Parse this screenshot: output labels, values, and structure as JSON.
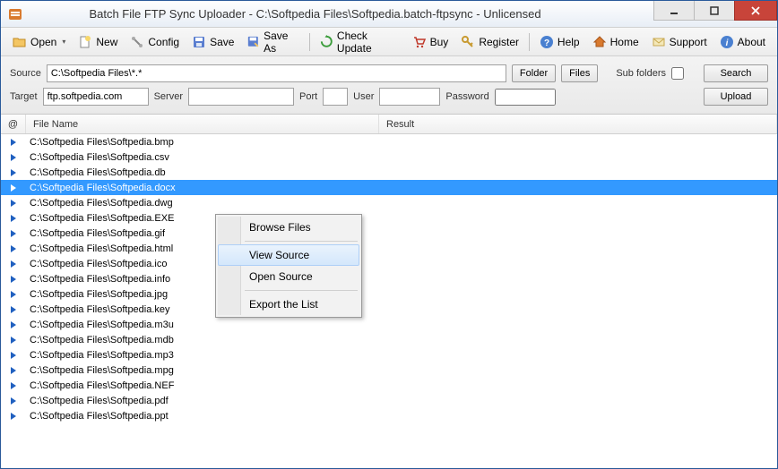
{
  "window": {
    "title": "Batch File FTP Sync Uploader - C:\\Softpedia Files\\Softpedia.batch-ftpsync - Unlicensed"
  },
  "toolbar": {
    "open": "Open",
    "new": "New",
    "config": "Config",
    "save": "Save",
    "saveas": "Save As",
    "checkupdate": "Check Update",
    "buy": "Buy",
    "register": "Register",
    "help": "Help",
    "home": "Home",
    "support": "Support",
    "about": "About"
  },
  "filters": {
    "source_label": "Source",
    "source_value": "C:\\Softpedia Files\\*.*",
    "folder_btn": "Folder",
    "files_btn": "Files",
    "subfolders_label": "Sub folders",
    "search_btn": "Search",
    "target_label": "Target",
    "target_value": "ftp.softpedia.com",
    "server_label": "Server",
    "server_value": "",
    "port_label": "Port",
    "port_value": "",
    "user_label": "User",
    "user_value": "",
    "password_label": "Password",
    "password_value": "",
    "upload_btn": "Upload"
  },
  "columns": {
    "at": "@",
    "filename": "File Name",
    "result": "Result"
  },
  "files": [
    {
      "name": "C:\\Softpedia Files\\Softpedia.bmp",
      "selected": false
    },
    {
      "name": "C:\\Softpedia Files\\Softpedia.csv",
      "selected": false
    },
    {
      "name": "C:\\Softpedia Files\\Softpedia.db",
      "selected": false
    },
    {
      "name": "C:\\Softpedia Files\\Softpedia.docx",
      "selected": true
    },
    {
      "name": "C:\\Softpedia Files\\Softpedia.dwg",
      "selected": false
    },
    {
      "name": "C:\\Softpedia Files\\Softpedia.EXE",
      "selected": false
    },
    {
      "name": "C:\\Softpedia Files\\Softpedia.gif",
      "selected": false
    },
    {
      "name": "C:\\Softpedia Files\\Softpedia.html",
      "selected": false
    },
    {
      "name": "C:\\Softpedia Files\\Softpedia.ico",
      "selected": false
    },
    {
      "name": "C:\\Softpedia Files\\Softpedia.info",
      "selected": false
    },
    {
      "name": "C:\\Softpedia Files\\Softpedia.jpg",
      "selected": false
    },
    {
      "name": "C:\\Softpedia Files\\Softpedia.key",
      "selected": false
    },
    {
      "name": "C:\\Softpedia Files\\Softpedia.m3u",
      "selected": false
    },
    {
      "name": "C:\\Softpedia Files\\Softpedia.mdb",
      "selected": false
    },
    {
      "name": "C:\\Softpedia Files\\Softpedia.mp3",
      "selected": false
    },
    {
      "name": "C:\\Softpedia Files\\Softpedia.mpg",
      "selected": false
    },
    {
      "name": "C:\\Softpedia Files\\Softpedia.NEF",
      "selected": false
    },
    {
      "name": "C:\\Softpedia Files\\Softpedia.pdf",
      "selected": false
    },
    {
      "name": "C:\\Softpedia Files\\Softpedia.ppt",
      "selected": false
    }
  ],
  "context_menu": {
    "browse_files": "Browse Files",
    "view_source": "View  Source",
    "open_source": "Open Source",
    "export_list": "Export the List"
  }
}
